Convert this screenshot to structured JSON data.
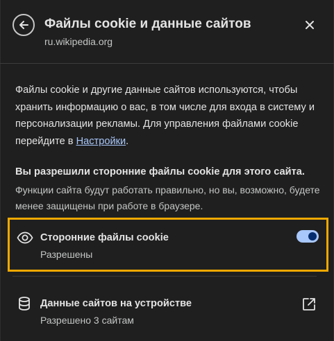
{
  "header": {
    "title": "Файлы cookie и данные сайтов",
    "subtitle": "ru.wikipedia.org",
    "back_icon": "arrow-left-icon",
    "close_icon": "close-icon"
  },
  "description": {
    "text": "Файлы cookie и другие данные сайтов используются, чтобы хранить информацию о вас, в том числе для входа в систему и персонализации рекламы. Для управления файлами cookie перейдите в ",
    "link_label": "Настройки",
    "text_end": "."
  },
  "notice": {
    "title": "Вы разрешили сторонние файлы cookie для этого сайта.",
    "body": "Функции сайта будут работать правильно, но вы, возможно, будете менее защищены при работе в браузере."
  },
  "third_party_cookies": {
    "icon": "eye-icon",
    "label": "Сторонние файлы cookie",
    "status": "Разрешены",
    "toggle_on": true
  },
  "site_data": {
    "icon": "database-icon",
    "label": "Данные сайтов на устройстве",
    "status": "Разрешено 3 сайтам",
    "action_icon": "external-link-icon"
  },
  "colors": {
    "background": "#1f1f1f",
    "text": "#e3e3e3",
    "secondary_text": "#c4c7c5",
    "link": "#a8c7fa",
    "toggle_track": "#a8c7fa",
    "toggle_knob": "#062e6f",
    "highlight": "#f2a900"
  }
}
